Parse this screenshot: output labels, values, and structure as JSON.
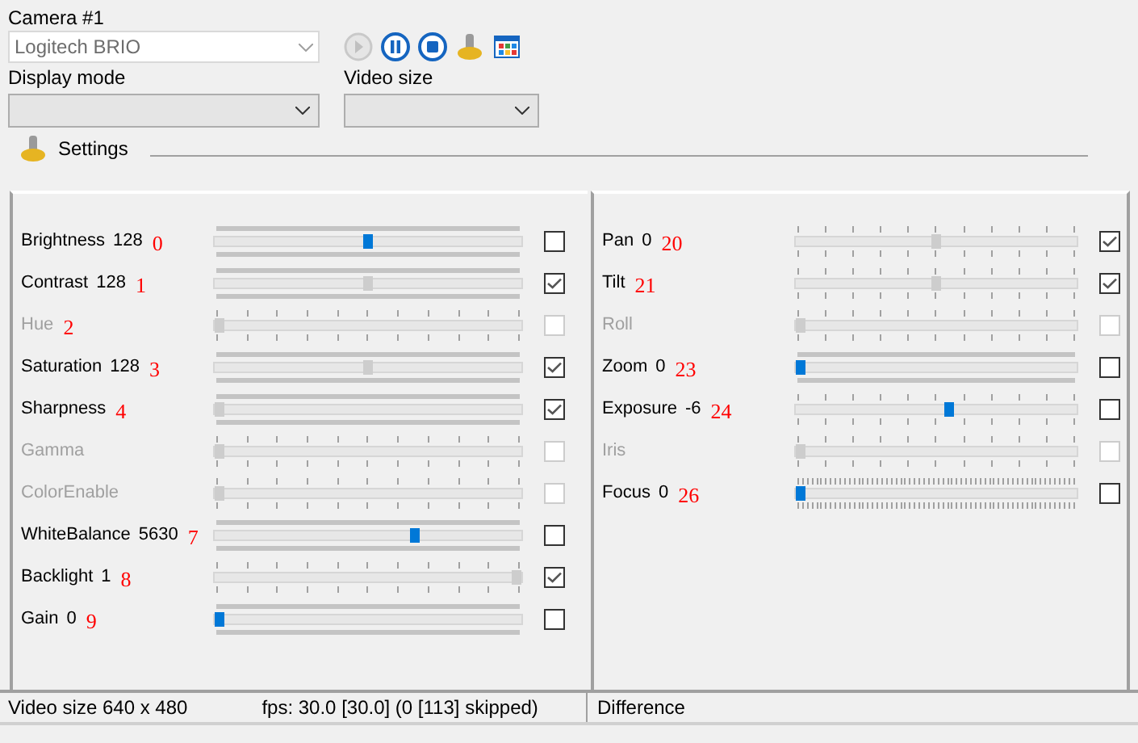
{
  "camera": {
    "label": "Camera #1",
    "device": "Logitech BRIO"
  },
  "toolbar": [
    {
      "kind": "play",
      "disabled": true
    },
    {
      "kind": "pause",
      "disabled": false
    },
    {
      "kind": "stop",
      "disabled": false
    },
    {
      "kind": "settings",
      "disabled": false
    },
    {
      "kind": "window",
      "disabled": false
    }
  ],
  "display_mode": {
    "label": "Display mode"
  },
  "video_size": {
    "label": "Video size"
  },
  "settings_header": "Settings",
  "left_controls": [
    {
      "name": "Brightness",
      "value": "128",
      "annotation": "0",
      "kind": "bars",
      "level": 0.5,
      "checked": false,
      "disabled": false
    },
    {
      "name": "Contrast",
      "value": "128",
      "annotation": "1",
      "kind": "bars",
      "level": 0.5,
      "checked": true,
      "disabled": false
    },
    {
      "name": "Hue",
      "annotation": "2",
      "kind": "ticks",
      "level": 0,
      "checked": false,
      "disabled": true
    },
    {
      "name": "Saturation",
      "value": "128",
      "annotation": "3",
      "kind": "bars",
      "level": 0.5,
      "checked": true,
      "disabled": false
    },
    {
      "name": "Sharpness",
      "annotation": "4",
      "kind": "bars",
      "level": 0,
      "checked": true,
      "disabled": false
    },
    {
      "name": "Gamma",
      "kind": "ticks",
      "level": 0,
      "checked": false,
      "disabled": true
    },
    {
      "name": "ColorEnable",
      "kind": "ticks",
      "level": 0,
      "checked": false,
      "disabled": true
    },
    {
      "name": "WhiteBalance",
      "value": "5630",
      "annotation": "7",
      "kind": "bars",
      "level": 0.66,
      "checked": false,
      "disabled": false
    },
    {
      "name": "Backlight",
      "value": "1",
      "annotation": "8",
      "kind": "ticks",
      "level": 1,
      "checked": true,
      "disabled": false
    },
    {
      "name": "Gain",
      "value": "0",
      "annotation": "9",
      "kind": "bars",
      "level": 0,
      "checked": false,
      "disabled": false
    }
  ],
  "right_controls": [
    {
      "name": "Pan",
      "value": "0",
      "annotation": "20",
      "kind": "ticks",
      "level": 0.5,
      "checked": true,
      "disabled": false
    },
    {
      "name": "Tilt",
      "annotation": "21",
      "kind": "ticks",
      "level": 0.5,
      "checked": true,
      "disabled": false
    },
    {
      "name": "Roll",
      "kind": "ticks",
      "level": 0,
      "checked": false,
      "disabled": true
    },
    {
      "name": "Zoom",
      "value": "0",
      "annotation": "23",
      "kind": "bars",
      "level": 0,
      "checked": false,
      "disabled": false
    },
    {
      "name": "Exposure",
      "value": "-6",
      "annotation": "24",
      "kind": "ticks",
      "level": 0.55,
      "checked": false,
      "disabled": false
    },
    {
      "name": "Iris",
      "kind": "ticks",
      "level": 0,
      "checked": false,
      "disabled": true
    },
    {
      "name": "Focus",
      "value": "0",
      "annotation": "26",
      "kind": "fine",
      "level": 0,
      "checked": false,
      "disabled": false
    }
  ],
  "status_bar": {
    "video_size": "Video size 640 x 480",
    "fps": "fps: 30.0 [30.0] (0 [113] skipped)",
    "mode": "Difference"
  }
}
